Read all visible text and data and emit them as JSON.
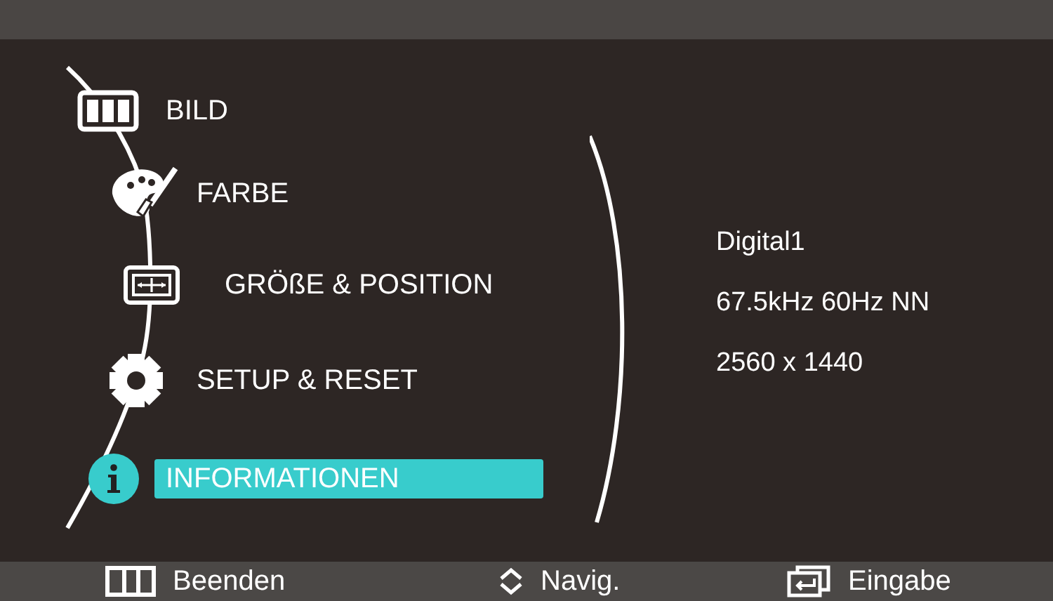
{
  "menu": {
    "items": [
      {
        "label": "BILD",
        "selected": false
      },
      {
        "label": "FARBE",
        "selected": false
      },
      {
        "label": "GRÖßE & POSITION",
        "selected": false
      },
      {
        "label": "SETUP & RESET",
        "selected": false
      },
      {
        "label": "INFORMATIONEN",
        "selected": true
      }
    ]
  },
  "info": {
    "lines": [
      "Digital1",
      "67.5kHz 60Hz NN",
      "2560 x 1440"
    ]
  },
  "footer": {
    "hints": [
      {
        "label": "Beenden"
      },
      {
        "label": "Navig."
      },
      {
        "label": "Eingabe"
      }
    ]
  }
}
